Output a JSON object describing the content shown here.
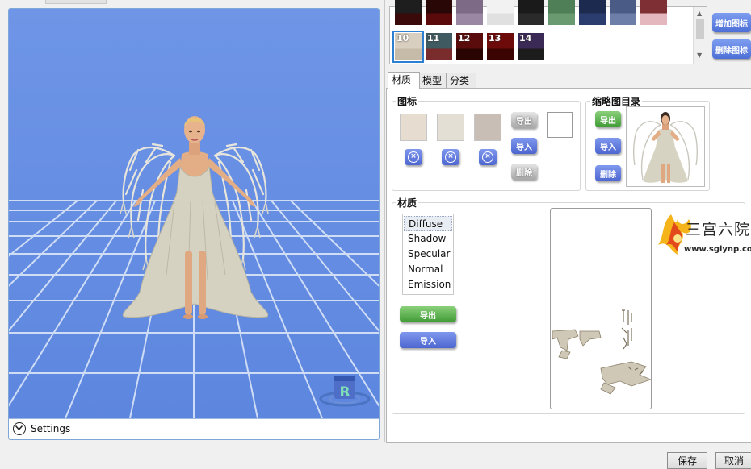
{
  "viewport": {
    "settings_label": "Settings",
    "badge_letter": "R"
  },
  "swatches": {
    "row1": [
      {
        "num": "",
        "color": "#1e1e1e",
        "band": "#3a0a0a"
      },
      {
        "num": "",
        "color": "#2a0707",
        "band": "#5a0a0a"
      },
      {
        "num": "",
        "color": "#7d6a86",
        "band": "#9a87a3"
      },
      {
        "num": "",
        "color": "#f2f2f2",
        "band": "#e0e0e0"
      },
      {
        "num": "",
        "color": "#1a1a1a",
        "band": "#2a2a2a"
      },
      {
        "num": "",
        "color": "#4f7f56",
        "band": "#6a9a6f"
      },
      {
        "num": "",
        "color": "#1c2a4f",
        "band": "#2b3d6e"
      },
      {
        "num": "",
        "color": "#4a5c86",
        "band": "#6d7fa8"
      },
      {
        "num": "",
        "color": "#7e2f34",
        "band": "#e4b6bd"
      }
    ],
    "row2": [
      {
        "num": "10",
        "color": "#d9cfc0",
        "band": "#c6bba8"
      },
      {
        "num": "11",
        "color": "#3f5a60",
        "band": "#7a2b2b"
      },
      {
        "num": "12",
        "color": "#5a0b0b",
        "band": "#2a0303"
      },
      {
        "num": "13",
        "color": "#6d0a0a",
        "band": "#3c0303"
      },
      {
        "num": "14",
        "color": "#3b2a55",
        "band": "#1c1c1c"
      }
    ]
  },
  "side_buttons": {
    "add": "增加图标",
    "remove": "删除图标"
  },
  "tabs": [
    {
      "label": "材质"
    },
    {
      "label": "模型"
    },
    {
      "label": "分类"
    }
  ],
  "icon_group": {
    "title": "图标",
    "export": "导出",
    "import": "导入",
    "delete": "删除",
    "swatch_colors": [
      "#e6ddd0",
      "#e4dfd4",
      "#c9beb6"
    ]
  },
  "thumb_group": {
    "title": "缩略图目录",
    "export": "导出",
    "import": "导入",
    "delete": "删除"
  },
  "material_group": {
    "title": "材质",
    "items": [
      "Diffuse",
      "Shadow",
      "Specular",
      "Normal",
      "Emission"
    ],
    "export": "导出",
    "import": "导入"
  },
  "watermark": {
    "name": "三宫六院",
    "url": "www.sglynp.com"
  },
  "footer": {
    "save": "保存",
    "cancel": "取消"
  }
}
